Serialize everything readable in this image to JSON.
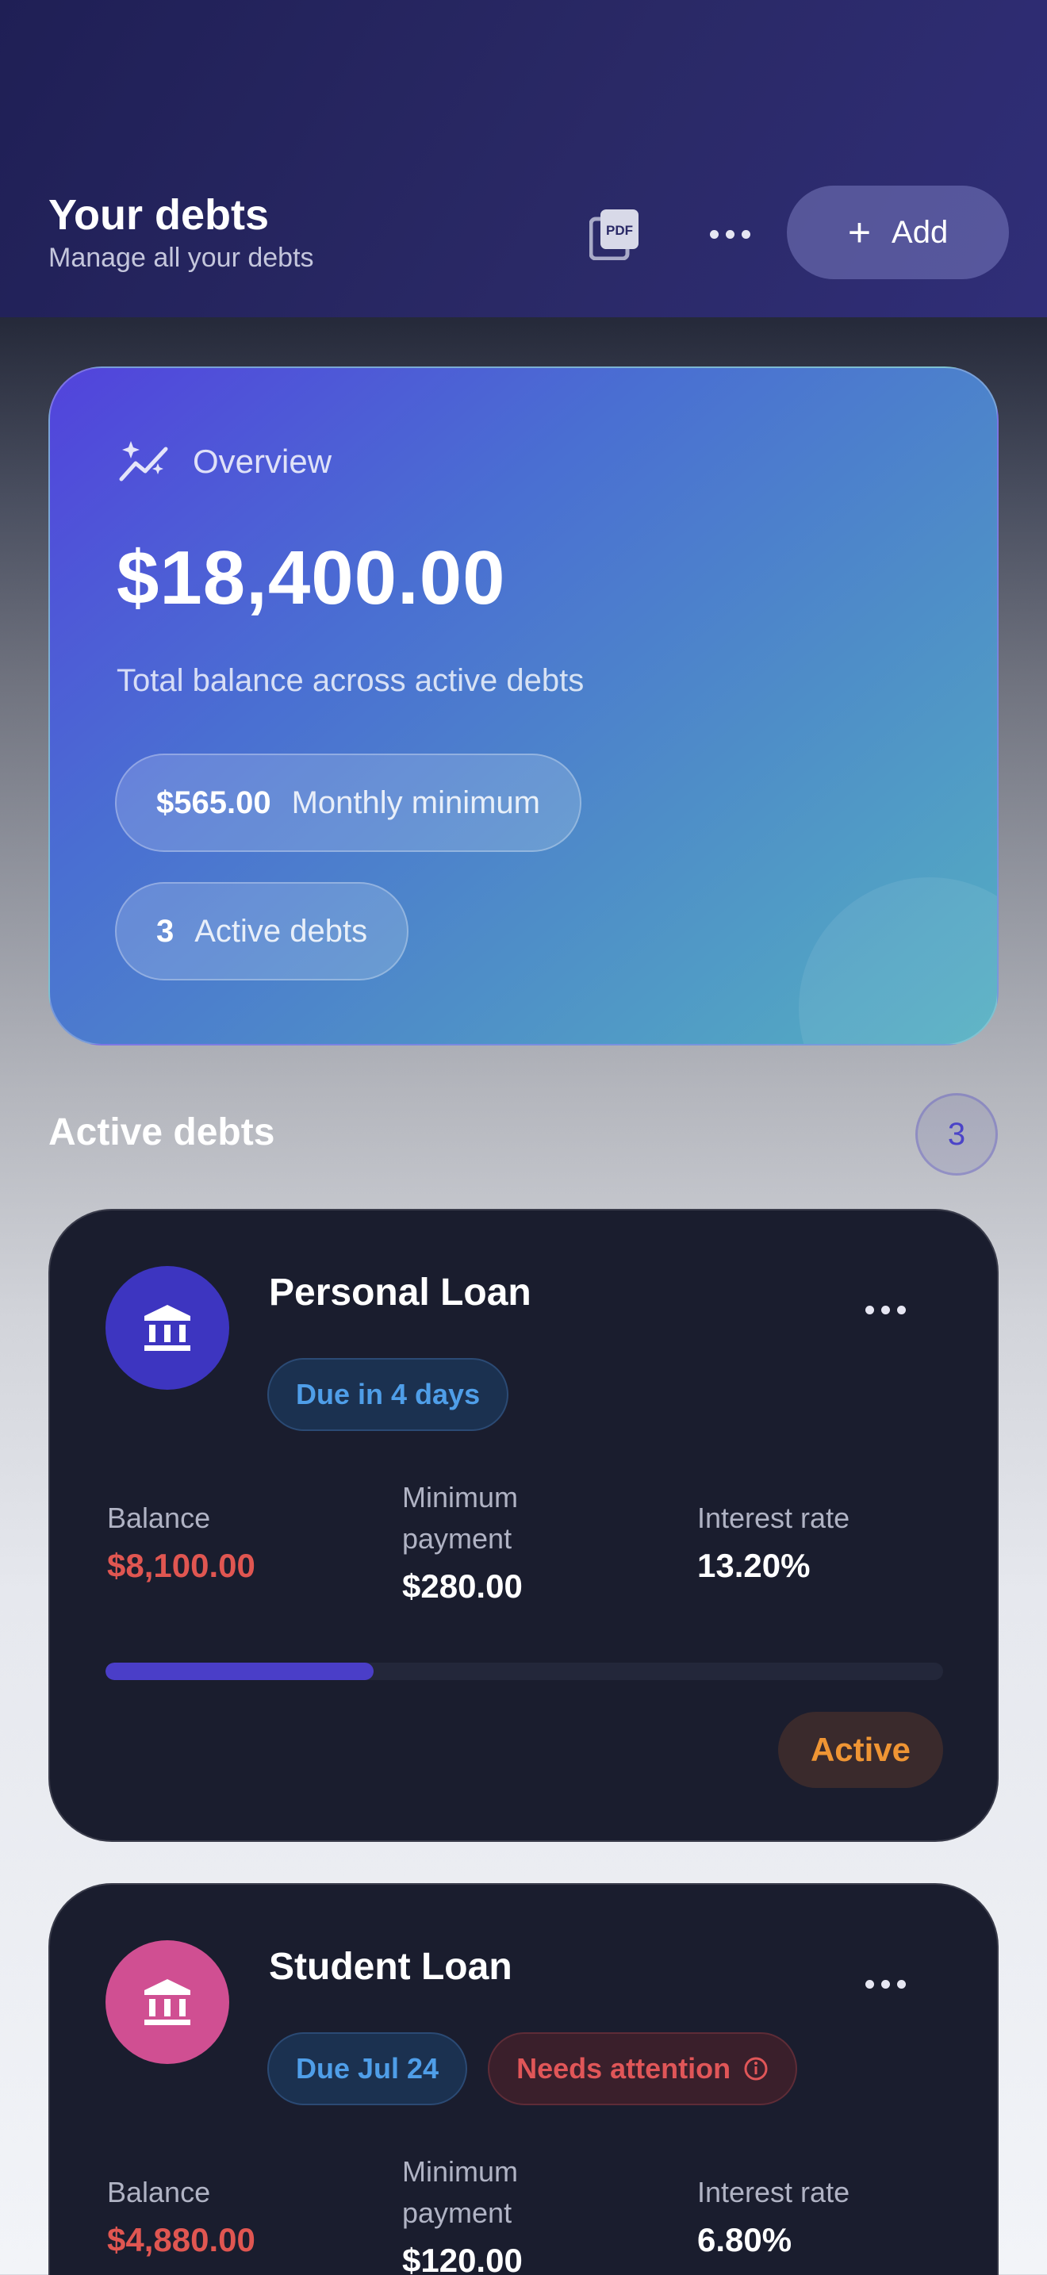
{
  "header": {
    "title": "Your debts",
    "subtitle": "Manage all your debts",
    "pdf_icon": "pdf-icon",
    "more_icon": "more-horizontal-icon",
    "add_label": "Add"
  },
  "overview": {
    "label": "Overview",
    "total": "$18,400.00",
    "description": "Total balance across active debts",
    "monthly_value": "$565.00",
    "monthly_label": "Monthly minimum",
    "active_value": "3",
    "active_label": "Active debts"
  },
  "section": {
    "title": "Active debts",
    "count": "3"
  },
  "debts": [
    {
      "name": "Personal Loan",
      "icon": "bank-icon",
      "avatar_color": "#3d35c0",
      "due": "Due in 4 days",
      "balance_label": "Balance",
      "balance": "$8,100.00",
      "min_label": "Minimum payment",
      "min_payment": "$280.00",
      "rate_label": "Interest rate",
      "rate": "13.20%",
      "progress": 0.32,
      "status": "Active"
    },
    {
      "name": "Student Loan",
      "icon": "bank-icon",
      "avatar_color": "#d04f92",
      "due": "Due Jul 24",
      "attention": "Needs attention",
      "balance_label": "Balance",
      "balance": "$4,880.00",
      "min_label": "Minimum payment",
      "min_payment": "$120.00",
      "rate_label": "Interest rate",
      "rate": "6.80%"
    }
  ]
}
